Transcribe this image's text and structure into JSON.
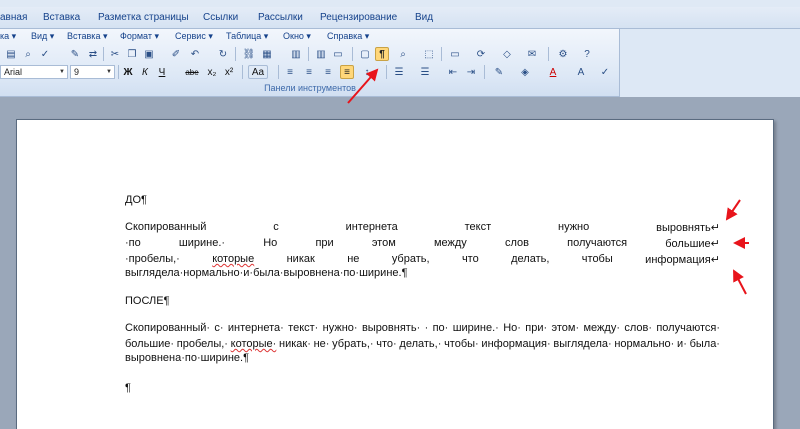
{
  "ribbon": {
    "tabs": [
      "авная",
      "Вставка",
      "Разметка страницы",
      "Ссылки",
      "Рассылки",
      "Рецензирование",
      "Вид"
    ],
    "menus": [
      "ка ▾",
      "Вид ▾",
      "Вставка ▾",
      "Формат ▾",
      "Сервис ▾",
      "Таблица ▾",
      "Окно ▾",
      "Справка ▾"
    ],
    "font_name": "Arial",
    "font_size": "9",
    "group_label": "Панели инструментов",
    "bold": "Ж",
    "italic": "К",
    "underline": "Ч",
    "strike": "abe",
    "subscript": "x₂",
    "superscript": "x²",
    "change_case": "Aa",
    "pilcrow": "¶"
  },
  "document": {
    "before_label": "ДО¶",
    "before_lines": [
      [
        "Скопированный",
        "с",
        "интернета",
        "текст",
        "нужно",
        "выровнять↵"
      ],
      [
        "·по",
        "ширине.·",
        "Но",
        "при",
        "этом",
        "между",
        "слов",
        "получаются",
        "большие↵"
      ],
      [
        "·пробелы,·",
        "которые",
        "никак",
        "не",
        "убрать,",
        "что",
        "делать,",
        "чтобы",
        "информация↵"
      ]
    ],
    "before_last": "выглядела·нормально·и·была·выровнена·по·ширине.¶",
    "after_label": "ПОСЛЕ¶",
    "after_lines": [
      [
        "Скопированный·",
        "с·",
        "интернета·",
        "текст·",
        "нужно·",
        "выровнять·",
        "·",
        "по·",
        "ширине.·",
        "Но·",
        "при·",
        "этом·",
        "между·",
        "слов·",
        "получаются·"
      ],
      [
        "большие·",
        "пробелы,·",
        "которые·",
        "никак·",
        "не·",
        "убрать,·",
        "что·",
        "делать,·",
        "чтобы·",
        "информация·",
        "выглядела·",
        "нормально·",
        "и·",
        "была·"
      ]
    ],
    "after_last": "выровнена·по·ширине.¶",
    "empty_para": "¶"
  },
  "colors": {
    "annotation_arrow": "#e8141b",
    "pressed_button": "#ffd77a"
  }
}
